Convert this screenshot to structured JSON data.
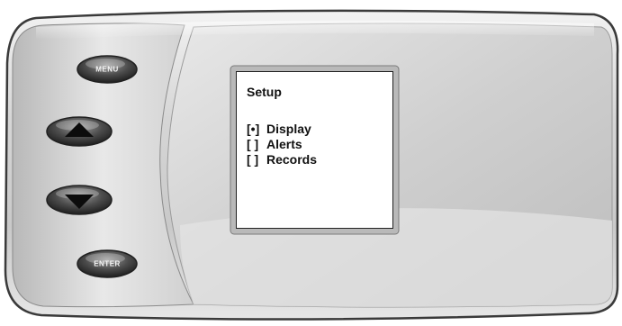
{
  "device": {
    "buttons": [
      {
        "id": "menu",
        "label": "MENU",
        "icon": "none"
      },
      {
        "id": "up",
        "label": "",
        "icon": "triangle-up-icon"
      },
      {
        "id": "down",
        "label": "",
        "icon": "triangle-down-icon"
      },
      {
        "id": "enter",
        "label": "ENTER",
        "icon": "none"
      }
    ],
    "colors": {
      "body": "#d9d9d9",
      "button": "#5a5a5a",
      "screen": "#ffffff",
      "text": "#111111"
    }
  },
  "screen": {
    "title": "Setup",
    "items": [
      {
        "mark": "[•]",
        "label": "Display",
        "selected": true
      },
      {
        "mark": "[ ]",
        "label": "Alerts",
        "selected": false
      },
      {
        "mark": "[ ]",
        "label": "Records",
        "selected": false
      }
    ]
  }
}
